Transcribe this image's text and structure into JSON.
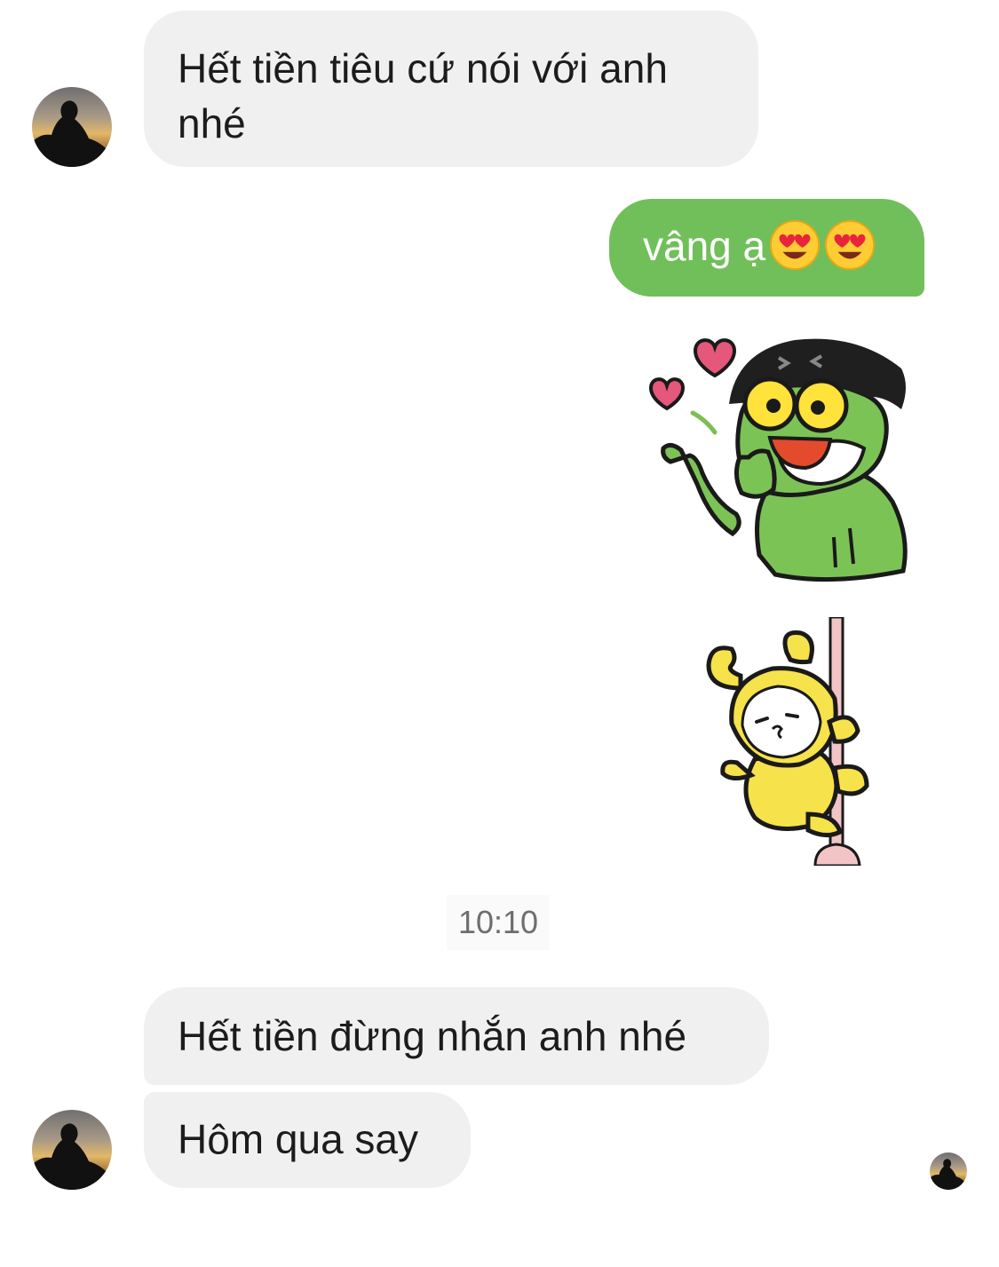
{
  "conversation": {
    "messages": [
      {
        "sender": "other",
        "text": "Hết tiền tiêu cứ nói với anh nhé"
      },
      {
        "sender": "me",
        "text": "vâng ạ",
        "emojis": [
          "heart-eyes-emoji",
          "heart-eyes-emoji"
        ]
      },
      {
        "sender": "me",
        "sticker": "frog-blowing-kisses-sticker"
      },
      {
        "sender": "me",
        "sticker": "yellow-rabbit-pole-sticker"
      },
      {
        "sender": "other",
        "text": "Hết tiền đừng nhắn anh nhé"
      },
      {
        "sender": "other",
        "text": "Hôm qua say"
      }
    ],
    "timestamp": "10:10"
  },
  "colors": {
    "incoming_bubble": "#f0f0f0",
    "outgoing_bubble": "#71bf5a",
    "timestamp_text": "#6e6e6e"
  }
}
